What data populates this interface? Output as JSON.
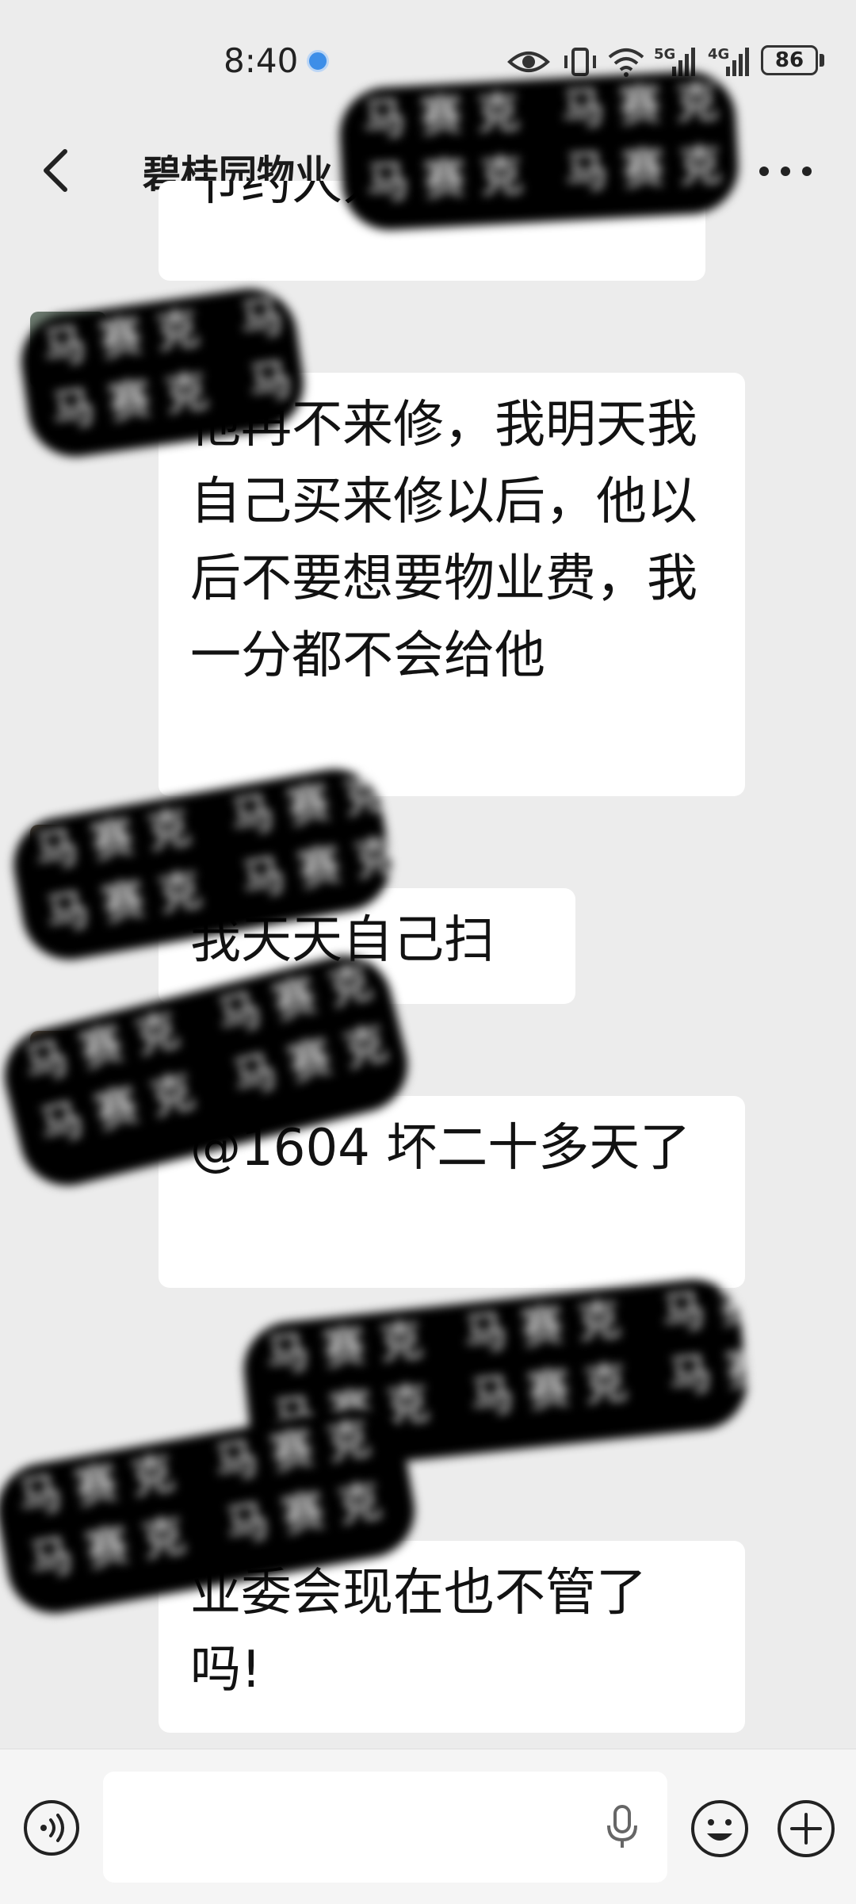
{
  "status_bar": {
    "time": "8:40",
    "network_1": "5G",
    "network_2": "4G",
    "battery": "86"
  },
  "header": {
    "title": "碧桂园物业"
  },
  "redaction_text": "马赛克 马赛克 马赛克",
  "messages": [
    {
      "text": "节约人力成本吗"
    },
    {
      "text": "他再不来修，我明天我自己买来修以后，他以后不要想要物业费，我一分都不会给他"
    },
    {
      "text": "我天天自己扫"
    },
    {
      "text": "@1604  坏二十多天了"
    },
    {
      "text": "业委会现在也不管了吗!"
    }
  ],
  "colors": {
    "background": "#ececec",
    "bubble": "#ffffff",
    "location_dot": "#3d8ee8"
  }
}
